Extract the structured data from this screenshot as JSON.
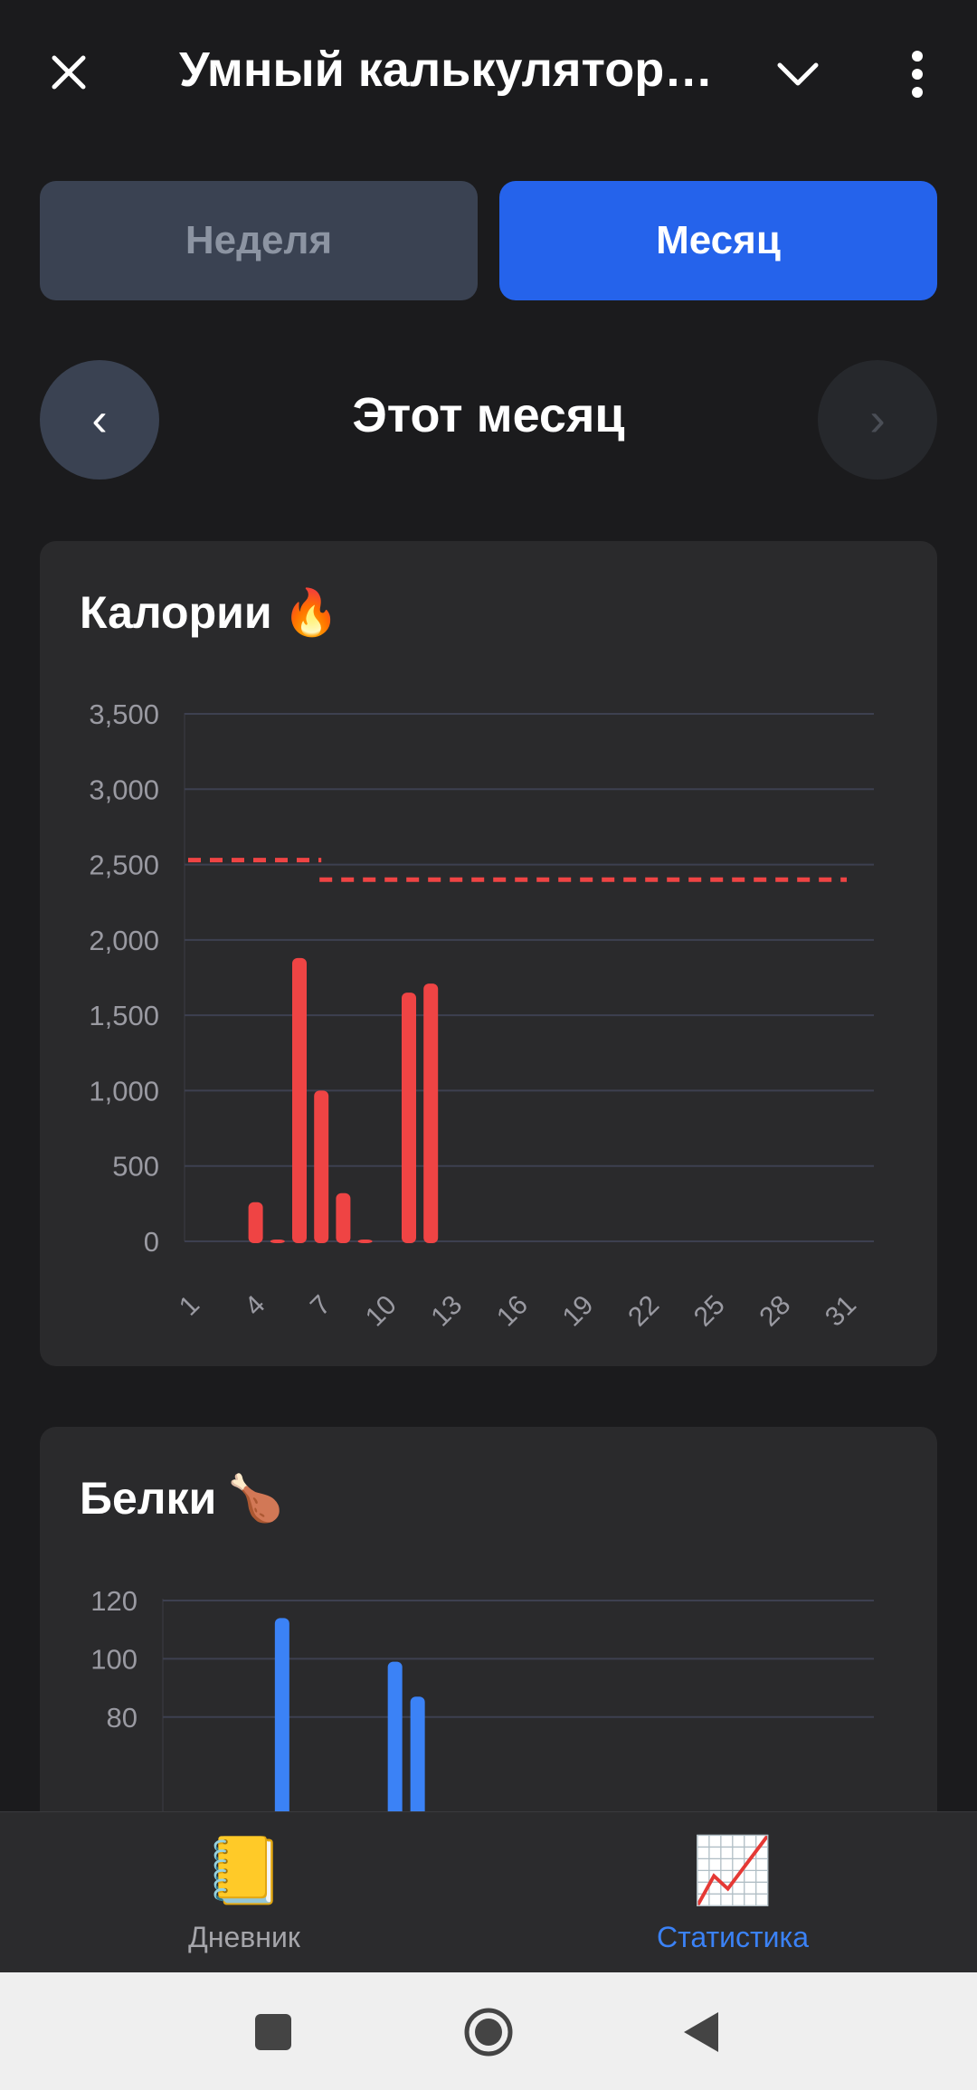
{
  "header": {
    "title": "Умный калькулятор…",
    "close_icon": "close-icon",
    "dropdown_icon": "chevron-down-icon",
    "menu_icon": "more-vertical-icon"
  },
  "period_tabs": [
    {
      "label": "Неделя",
      "active": false
    },
    {
      "label": "Месяц",
      "active": true
    }
  ],
  "period_nav": {
    "prev_glyph": "‹",
    "next_glyph": "›",
    "label": "Этот месяц"
  },
  "calories": {
    "title": "Калории",
    "emoji": "🔥"
  },
  "protein": {
    "title": "Белки",
    "emoji": "🍗"
  },
  "chart_data": [
    {
      "type": "bar",
      "title": "Калории 🔥",
      "x_ticks": [
        "1",
        "4",
        "7",
        "10",
        "13",
        "16",
        "19",
        "22",
        "25",
        "28",
        "31"
      ],
      "x_range": [
        1,
        31
      ],
      "y_ticks": [
        "0",
        "500",
        "1,000",
        "1,500",
        "2,000",
        "2,500",
        "3,000",
        "3,500"
      ],
      "ylim": [
        0,
        3500
      ],
      "grid": true,
      "color": "#ef4444",
      "points": [
        {
          "day": 4,
          "value": 260
        },
        {
          "day": 5,
          "value": 8
        },
        {
          "day": 6,
          "value": 1880
        },
        {
          "day": 7,
          "value": 1000
        },
        {
          "day": 8,
          "value": 320
        },
        {
          "day": 9,
          "value": 8
        },
        {
          "day": 11,
          "value": 1650
        },
        {
          "day": 12,
          "value": 1710
        }
      ],
      "goal_lines": [
        {
          "from_day": 1,
          "to_day": 7,
          "value": 2530
        },
        {
          "from_day": 7,
          "to_day": 31,
          "value": 2400
        }
      ],
      "goal_color": "#ef4444"
    },
    {
      "type": "bar",
      "title": "Белки 🍗",
      "x_range": [
        1,
        31
      ],
      "y_ticks": [
        "80",
        "100",
        "120"
      ],
      "ylim": [
        0,
        120
      ],
      "grid": true,
      "color": "#3b82f6",
      "points": [
        {
          "day": 6,
          "value": 114
        },
        {
          "day": 11,
          "value": 99
        },
        {
          "day": 12,
          "value": 87
        }
      ]
    }
  ],
  "bottom_nav": [
    {
      "label": "Дневник",
      "icon": "📒",
      "active": false
    },
    {
      "label": "Статистика",
      "icon": "📈",
      "active": true
    }
  ],
  "system_nav": {
    "recents_icon": "square-icon",
    "home_icon": "circle-home-icon",
    "back_icon": "triangle-back-icon"
  }
}
